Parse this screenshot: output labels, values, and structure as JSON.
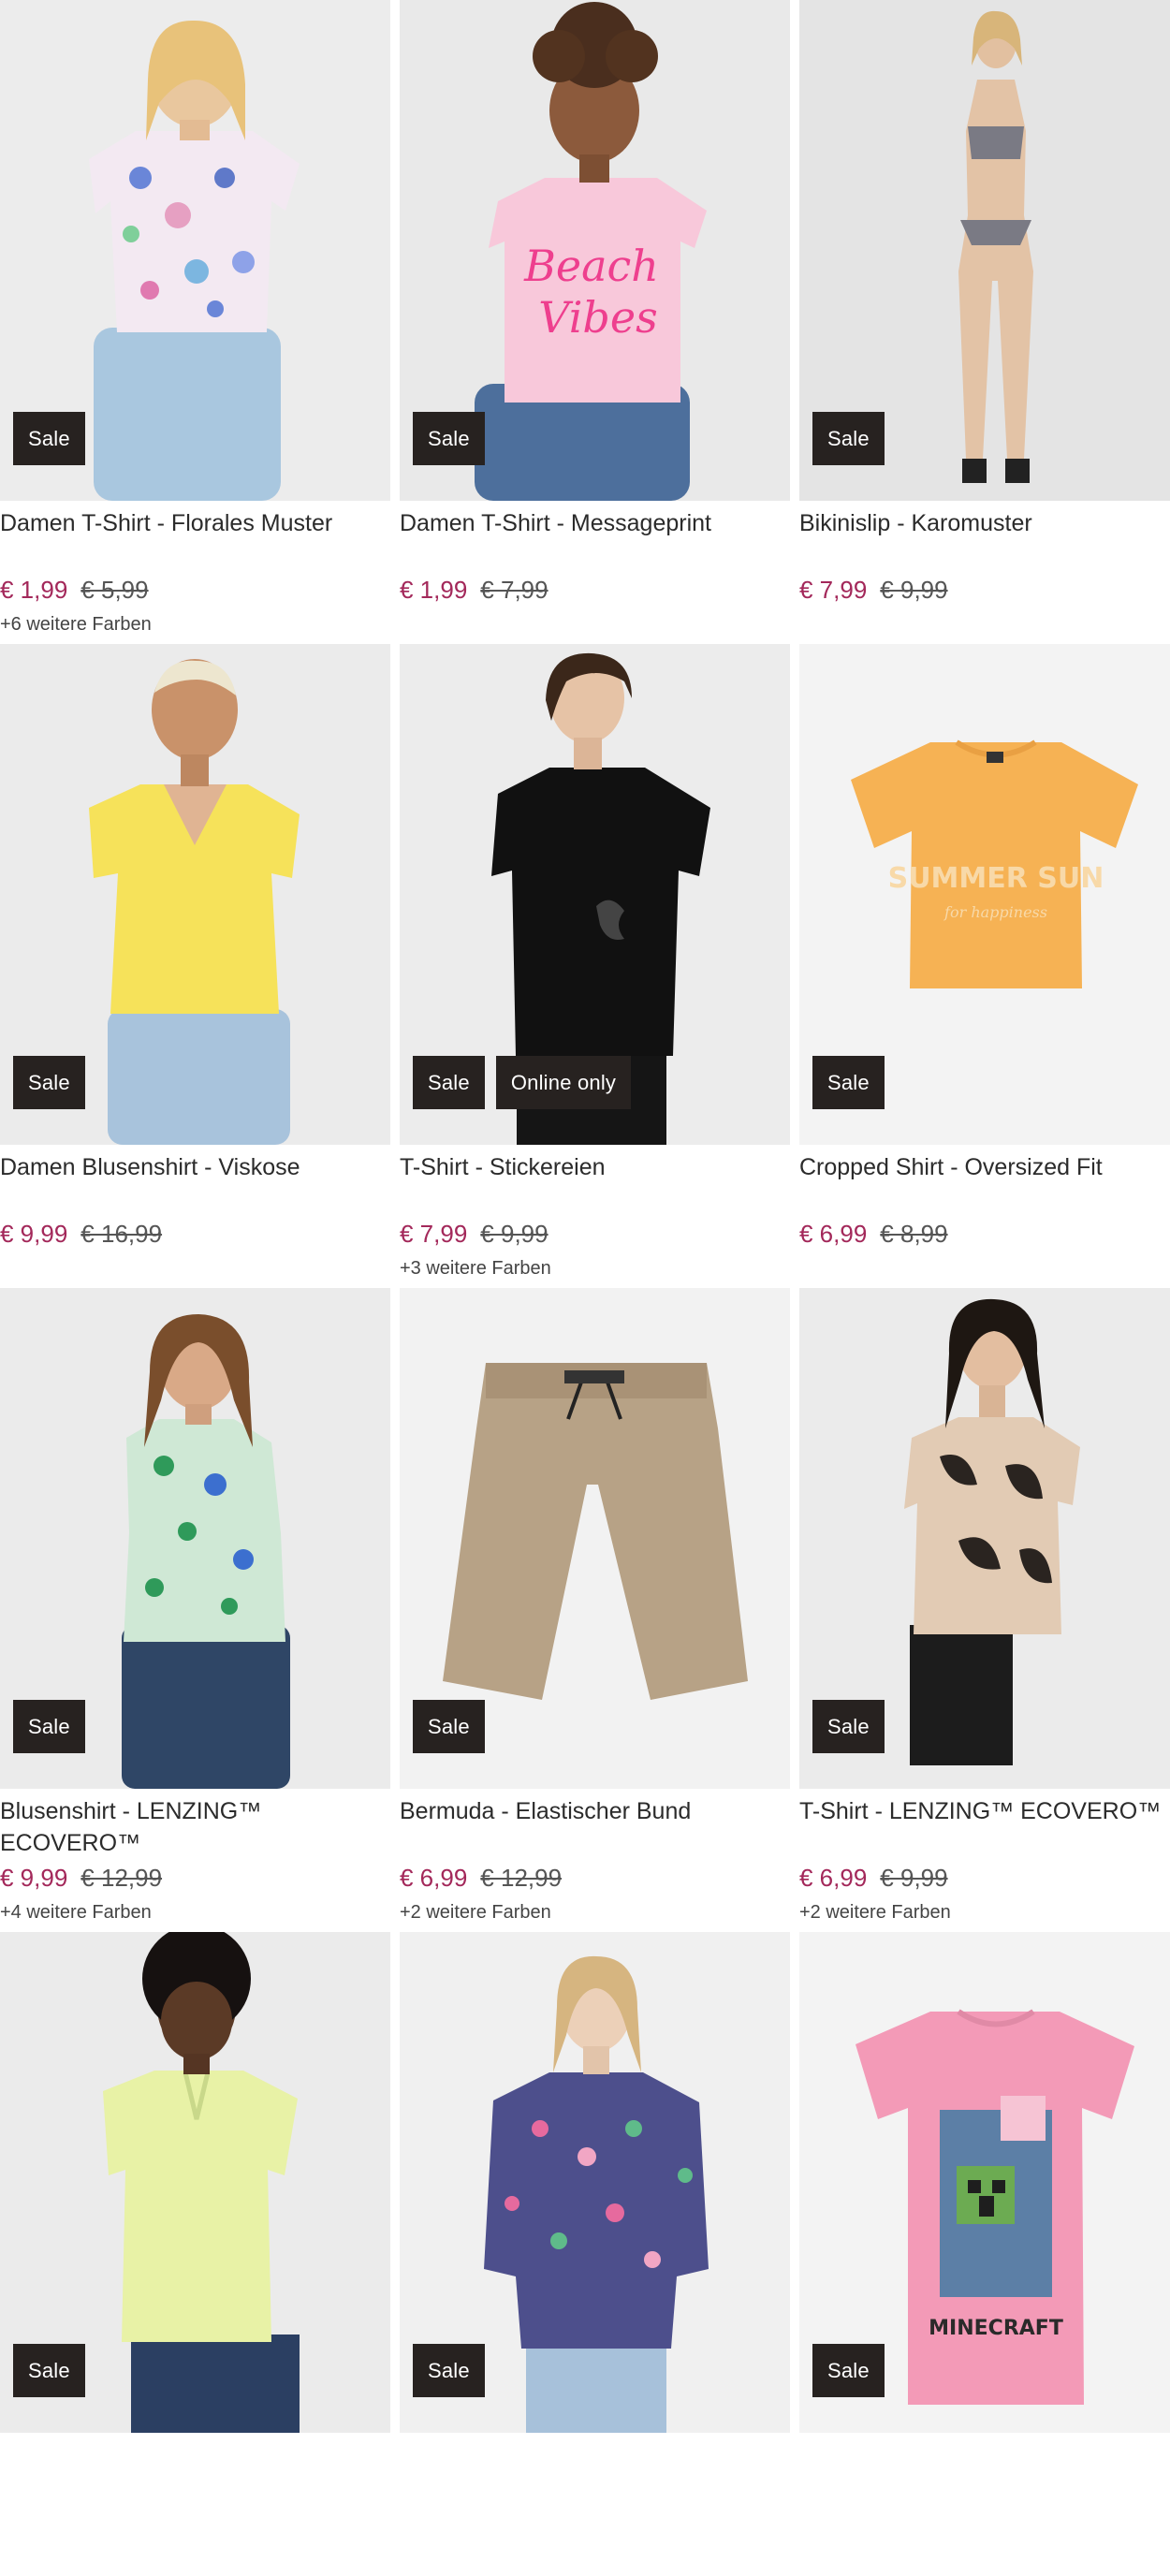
{
  "products": [
    {
      "title": "Damen T-Shirt - Florales Muster",
      "price": "€ 1,99",
      "old_price": "€ 5,99",
      "colors": "+6 weitere Farben",
      "badges": [
        "Sale"
      ],
      "image": "model-floral-tshirt"
    },
    {
      "title": "Damen T-Shirt - Messageprint",
      "price": "€ 1,99",
      "old_price": "€ 7,99",
      "colors": "",
      "badges": [
        "Sale"
      ],
      "image": "model-pink-beach-vibes-tshirt"
    },
    {
      "title": "Bikinislip - Karomuster",
      "price": "€ 7,99",
      "old_price": "€ 9,99",
      "colors": "",
      "badges": [
        "Sale"
      ],
      "image": "model-checked-bikini"
    },
    {
      "title": "Damen Blusenshirt - Viskose",
      "price": "€ 9,99",
      "old_price": "€ 16,99",
      "colors": "",
      "badges": [
        "Sale"
      ],
      "image": "model-yellow-blouse"
    },
    {
      "title": "T-Shirt - Stickereien",
      "price": "€ 7,99",
      "old_price": "€ 9,99",
      "colors": "+3 weitere Farben",
      "badges": [
        "Sale",
        "Online only"
      ],
      "image": "model-black-tshirt"
    },
    {
      "title": "Cropped Shirt - Oversized Fit",
      "price": "€ 6,99",
      "old_price": "€ 8,99",
      "colors": "",
      "badges": [
        "Sale"
      ],
      "image": "orange-summer-sun-crop-shirt"
    },
    {
      "title": "Blusenshirt - LENZING™ ECOVERO™",
      "price": "€ 9,99",
      "old_price": "€ 12,99",
      "colors": "+4 weitere Farben",
      "badges": [
        "Sale"
      ],
      "image": "model-green-print-blouse"
    },
    {
      "title": "Bermuda - Elastischer Bund",
      "price": "€ 6,99",
      "old_price": "€ 12,99",
      "colors": "+2 weitere Farben",
      "badges": [
        "Sale"
      ],
      "image": "beige-bermuda-shorts"
    },
    {
      "title": "T-Shirt - LENZING™ ECOVERO™",
      "price": "€ 6,99",
      "old_price": "€ 9,99",
      "colors": "+2 weitere Farben",
      "badges": [
        "Sale"
      ],
      "image": "model-leaf-print-tshirt"
    },
    {
      "title": "",
      "price": "",
      "old_price": "",
      "colors": "",
      "badges": [
        "Sale"
      ],
      "image": "model-lime-tshirt"
    },
    {
      "title": "",
      "price": "",
      "old_price": "",
      "colors": "",
      "badges": [
        "Sale"
      ],
      "image": "model-floral-longsleeve"
    },
    {
      "title": "",
      "price": "",
      "old_price": "",
      "colors": "",
      "badges": [
        "Sale"
      ],
      "image": "pink-minecraft-tshirt"
    }
  ],
  "colors": {
    "sale_price": "#a3285a",
    "badge_bg": "#272220",
    "photo_bg": "#eeeeee"
  }
}
